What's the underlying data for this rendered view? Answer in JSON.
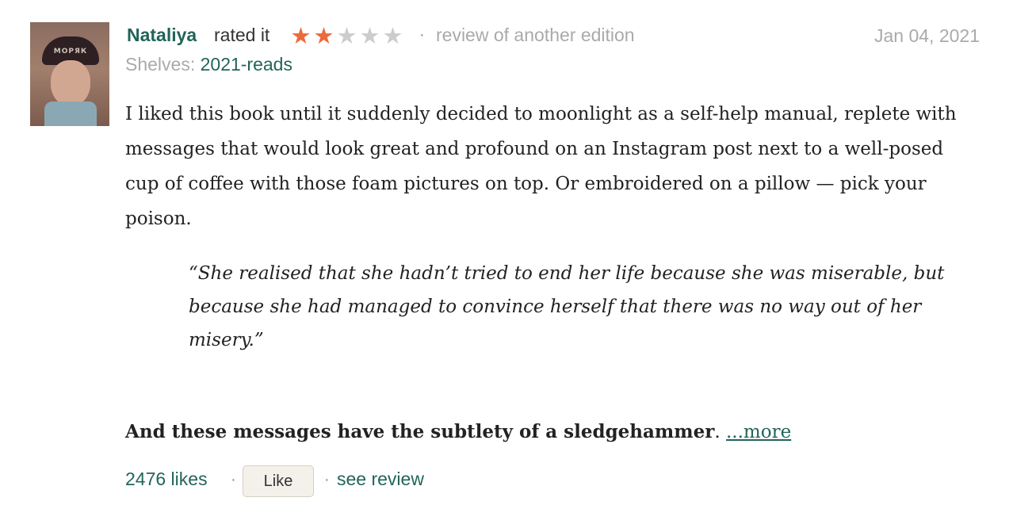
{
  "avatar": {
    "cap_text": "МОРЯК",
    "icon": "user-avatar"
  },
  "review": {
    "user_name": "Nataliya",
    "rated_text": "rated it",
    "rating": 2,
    "rating_max": 5,
    "separator": "·",
    "edition_note": "review of another edition",
    "date": "Jan 04, 2021",
    "shelves_label": "Shelves:",
    "shelf": "2021-reads",
    "body": "I liked this book until it suddenly decided to moonlight as a self-help manual, replete with messages that would look great and profound on an Instagram post next to a well-posed cup of coffee with those foam pictures on top. Or embroidered on a pillow — pick your poison.",
    "quote": "“She realised that she hadn’t tried to end her life because she was miserable, but because she had managed to convince herself that there was no way out of her misery.”",
    "closing_bold": "And these messages have the subtlety of a sledgehammer",
    "closing_end": ".",
    "more_link": "...more"
  },
  "footer": {
    "likes": "2476 likes",
    "like_button": "Like",
    "see_review": "see review"
  },
  "colors": {
    "link_green": "#22645a",
    "star_orange": "#ec6a3c",
    "muted_gray": "#aaaaaa"
  }
}
